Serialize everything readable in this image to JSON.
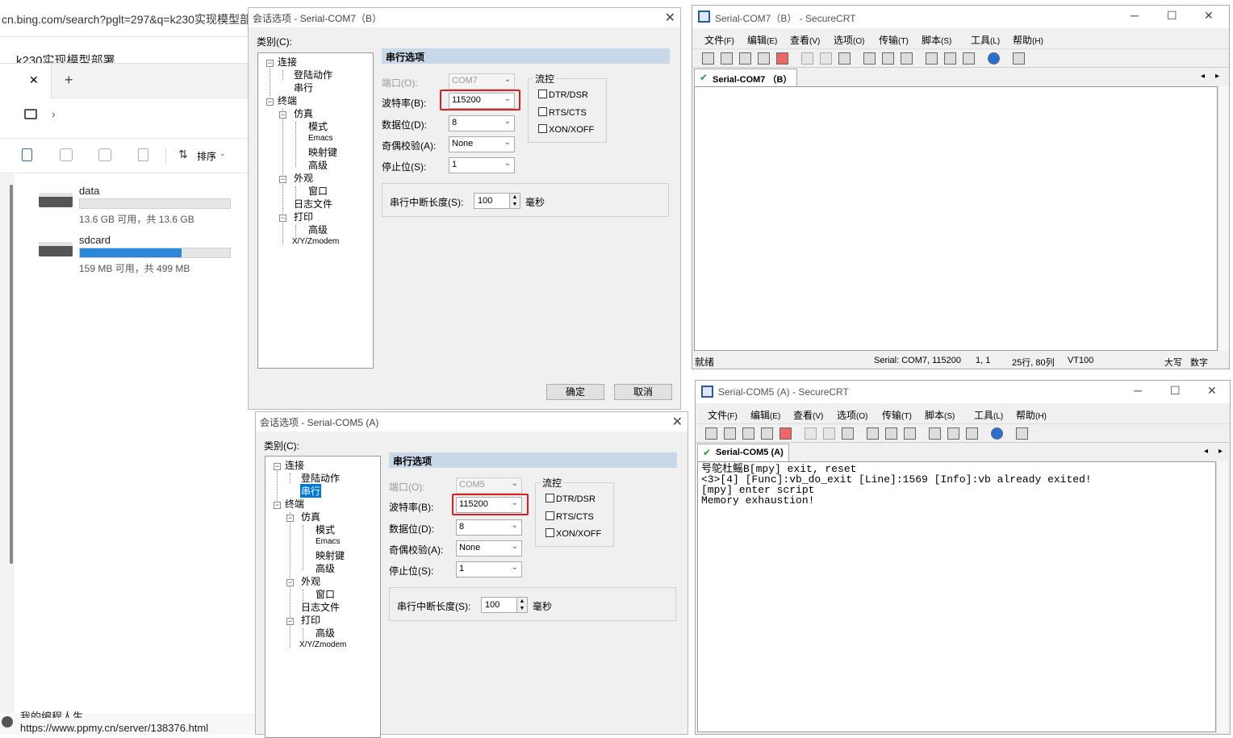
{
  "browser": {
    "url": "cn.bing.com/search?pglt=297&q=k230实现模型部",
    "page_title": "k230实现模型部署",
    "status_site": "我的编程人生",
    "status_url": "https://www.ppmy.cn/server/138376.html"
  },
  "explorer": {
    "tab_close": "✕",
    "tab_add": "+",
    "sort_label": "排序",
    "drives": [
      {
        "name": "data",
        "info": "13.6 GB 可用，共 13.6 GB",
        "used_fraction": 0.0
      },
      {
        "name": "sdcard",
        "info": "159 MB 可用，共 499 MB",
        "used_fraction": 0.68
      }
    ]
  },
  "dialog_top": {
    "title": "会话选项 - Serial-COM7（B）",
    "close": "✕",
    "category_label": "类别(C):",
    "tree": {
      "connection": "连接",
      "login_actions": "登陆动作",
      "serial": "串行",
      "terminal": "终端",
      "emulation": "仿真",
      "modes": "模式",
      "emacs": "Emacs",
      "mapped_keys": "映射键",
      "advanced": "高级",
      "appearance": "外观",
      "window": "窗口",
      "log_file": "日志文件",
      "print": "打印",
      "print_advanced": "高级",
      "xyz": "X/Y/Zmodem"
    },
    "section_header": "串行选项",
    "port_label": "端口(O):",
    "port_value": "COM7",
    "baud_label": "波特率(B):",
    "baud_value": "115200",
    "databits_label": "数据位(D):",
    "databits_value": "8",
    "parity_label": "奇偶校验(A):",
    "parity_value": "None",
    "stopbits_label": "停止位(S):",
    "stopbits_value": "1",
    "flow_label": "流控",
    "dtr": "DTR/DSR",
    "rts": "RTS/CTS",
    "xon": "XON/XOFF",
    "break_label": "串行中断长度(S):",
    "break_value": "100",
    "break_unit": "毫秒",
    "ok": "确定",
    "cancel": "取消"
  },
  "dialog_bottom": {
    "title": "会话选项 - Serial-COM5 (A)",
    "close": "✕",
    "category_label": "类别(C):",
    "tree": {
      "connection": "连接",
      "login_actions": "登陆动作",
      "serial": "串行",
      "terminal": "终端",
      "emulation": "仿真",
      "modes": "模式",
      "emacs": "Emacs",
      "mapped_keys": "映射键",
      "advanced": "高级",
      "appearance": "外观",
      "window": "窗口",
      "log_file": "日志文件",
      "print": "打印",
      "print_advanced": "高级",
      "xyz": "X/Y/Zmodem"
    },
    "section_header": "串行选项",
    "port_label": "端口(O):",
    "port_value": "COM5",
    "baud_label": "波特率(B):",
    "baud_value": "115200",
    "databits_label": "数据位(D):",
    "databits_value": "8",
    "parity_label": "奇偶校验(A):",
    "parity_value": "None",
    "stopbits_label": "停止位(S):",
    "stopbits_value": "1",
    "flow_label": "流控",
    "dtr": "DTR/DSR",
    "rts": "RTS/CTS",
    "xon": "XON/XOFF",
    "break_label": "串行中断长度(S):",
    "break_value": "100",
    "break_unit": "毫秒"
  },
  "crt_com7": {
    "title": "Serial-COM7（B） - SecureCRT",
    "minimize": "─",
    "maximize": "☐",
    "close": "✕",
    "menu": [
      "文件",
      "编辑",
      "查看",
      "选项",
      "传输",
      "脚本",
      "工具",
      "帮助"
    ],
    "menu_keys": [
      "(F)",
      "(E)",
      "(V)",
      "(O)",
      "(T)",
      "(S)",
      "(L)",
      "(H)"
    ],
    "tab": "Serial-COM7 （B）",
    "status_ready": "就绪",
    "status_serial": "Serial: COM7, 115200",
    "status_pos": "1,  1",
    "status_size": "25行, 80列",
    "status_term": "VT100",
    "status_caps": "大写",
    "status_num": "数字"
  },
  "crt_com5": {
    "title": "Serial-COM5 (A) - SecureCRT",
    "minimize": "─",
    "maximize": "☐",
    "close": "✕",
    "menu": [
      "文件",
      "编辑",
      "查看",
      "选项",
      "传输",
      "脚本",
      "工具",
      "帮助"
    ],
    "menu_keys": [
      "(F)",
      "(E)",
      "(V)",
      "(O)",
      "(T)",
      "(S)",
      "(L)",
      "(H)"
    ],
    "tab": "Serial-COM5 (A)",
    "terminal_lines": [
      "号鸵杜鳐B[mpy] exit, reset",
      "<3>[4] [Func]:vb_do_exit [Line]:1569 [Info]:vb already exited!",
      "[mpy] enter script",
      "Memory exhaustion!"
    ]
  },
  "colors": {
    "highlight": "#e02020",
    "section": "#c8d8e8",
    "selected": "#0078d7",
    "progress": "#2b88d8"
  }
}
